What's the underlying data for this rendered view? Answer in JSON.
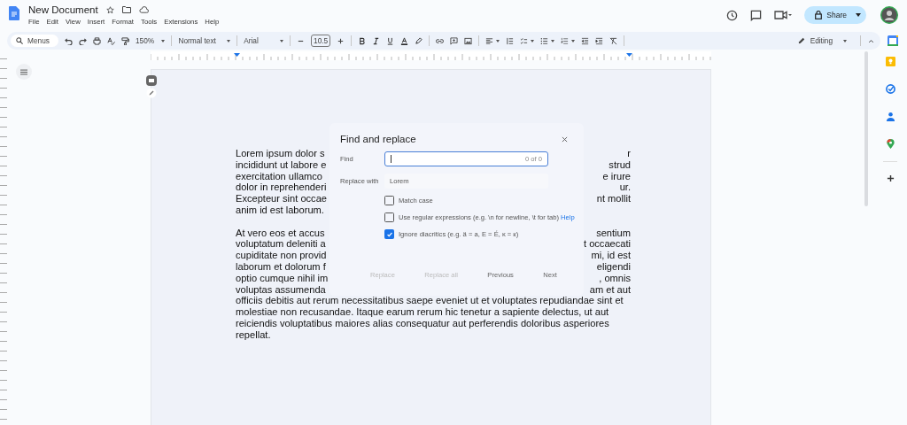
{
  "app": {
    "title": "New Document",
    "menus": [
      "File",
      "Edit",
      "View",
      "Insert",
      "Format",
      "Tools",
      "Extensions",
      "Help"
    ]
  },
  "share": {
    "label": "Share"
  },
  "toolbar": {
    "search_label": "Menus",
    "zoom": "150%",
    "style": "Normal text",
    "font": "Arial",
    "font_size": "10.5",
    "mode": "Editing"
  },
  "document": {
    "paragraphs": [
      {
        "lines": [
          {
            "left": "Lorem ipsum dolor s",
            "right": "r"
          },
          {
            "left": "incididunt ut labore e",
            "right": "strud"
          },
          {
            "left": "exercitation ullamco",
            "right": "e irure"
          },
          {
            "left": "dolor in reprehenderi",
            "right": "ur."
          },
          {
            "left": "Excepteur sint occae",
            "right": "nt mollit"
          },
          {
            "left": "anim id est laborum."
          }
        ]
      },
      {
        "lines": [
          {
            "left": "At vero eos et accus",
            "right": "sentium"
          },
          {
            "left": "voluptatum deleniti a",
            "right": "t occaecati"
          },
          {
            "left": "cupiditate non provid",
            "right": "mi, id est"
          },
          {
            "left": "laborum et dolorum f",
            "right": "eligendi"
          },
          {
            "left": "optio cumque nihil im",
            "right": ", omnis"
          },
          {
            "left": "voluptas assumenda",
            "right": "am et aut"
          },
          {
            "left": "officiis debitis aut rerum necessitatibus saepe eveniet ut et voluptates repudiandae sint et"
          },
          {
            "left": "molestiae non recusandae. Itaque earum rerum hic tenetur a sapiente delectus, ut aut"
          },
          {
            "left": "reiciendis voluptatibus maiores alias consequatur aut perferendis doloribus asperiores"
          },
          {
            "left": "repellat."
          }
        ]
      }
    ]
  },
  "dialog": {
    "title": "Find and replace",
    "find": {
      "label": "Find",
      "focused": true,
      "count": "0 of 0"
    },
    "replace": {
      "label": "Replace with",
      "value": "Lorem"
    },
    "options": [
      {
        "label": "Match case",
        "checked": false
      },
      {
        "label": "Use regular expressions (e.g. \\n for newline, \\t for tab)",
        "link": "Help",
        "checked": false
      },
      {
        "label": "Ignore diacritics (e.g. ä = a, E = É, ĸ = к)",
        "checked": true
      }
    ],
    "buttons": [
      {
        "label": "Replace",
        "disabled": true
      },
      {
        "label": "Replace all",
        "disabled": true
      },
      {
        "label": "Previous",
        "disabled": false
      },
      {
        "label": "Next",
        "disabled": false
      }
    ]
  }
}
